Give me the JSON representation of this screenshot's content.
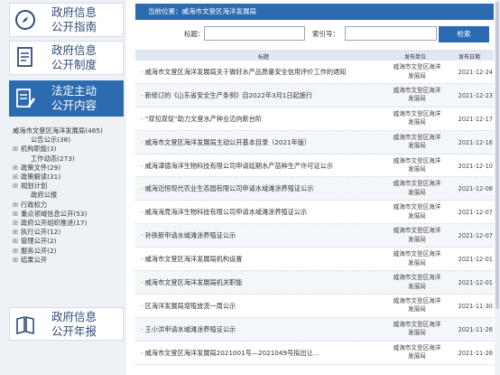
{
  "sidebar": {
    "nav": [
      {
        "line1": "政府信息",
        "line2": "公开指南",
        "icon": "compass-icon"
      },
      {
        "line1": "政府信息",
        "line2": "公开制度",
        "icon": "document-icon"
      },
      {
        "line1": "法定主动",
        "line2": "公开内容",
        "icon": "edit-document-icon"
      },
      {
        "line1": "政府信息",
        "line2": "公开年报",
        "icon": "report-icon"
      }
    ],
    "tree": {
      "root": "威海市文登区海洋发展局(465)",
      "items": [
        {
          "label": "公告公示(38)",
          "expandable": false
        },
        {
          "label": "机构职能(3)",
          "expandable": true
        },
        {
          "label": "工作动态(273)",
          "expandable": false
        },
        {
          "label": "政策文件(29)",
          "expandable": true
        },
        {
          "label": "政策解读(31)",
          "expandable": true
        },
        {
          "label": "规划计划",
          "expandable": true
        },
        {
          "label": "政府公报",
          "expandable": false
        },
        {
          "label": "行政权力",
          "expandable": true
        },
        {
          "label": "重点领域信息公开(53)",
          "expandable": true
        },
        {
          "label": "政府公开组织推进(17)",
          "expandable": true
        },
        {
          "label": "执行公开(12)",
          "expandable": true
        },
        {
          "label": "管理公开(2)",
          "expandable": true
        },
        {
          "label": "服务公开(2)",
          "expandable": true
        },
        {
          "label": "结果公开",
          "expandable": true
        }
      ]
    }
  },
  "content": {
    "breadcrumb": "当前位置：威海市文登区海洋发展局",
    "search": {
      "title_label": "标题：",
      "index_label": "索引号：",
      "button_label": "检索",
      "title_value": "",
      "index_value": ""
    },
    "table": {
      "headers": {
        "title": "标题",
        "unit": "发布单位",
        "date": "发布日期"
      },
      "rows": [
        {
          "title": "· 威海市文登区海洋发展局关于做好水产品质量安全信用评价工作的通知",
          "unit": "威海市文登区海洋发展局",
          "date": "2021-12-24"
        },
        {
          "title": "· 新修订的《山东省安全生产条例》自2022年3月1日起施行",
          "unit": "威海市文登区海洋发展局",
          "date": "2021-12-23"
        },
        {
          "title": "· “双包双促”助力文登水产种业迈向新台阶",
          "unit": "威海市文登区海洋发展局",
          "date": "2021-12-17"
        },
        {
          "title": "· 威海市文登区海洋发展局主动公开基本目录（2021年版）",
          "unit": "威海市文登区海洋发展局",
          "date": "2021-12-16"
        },
        {
          "title": "· 威海津德海洋生物科技有限公司申请延期水产苗种生产许可证公示",
          "unit": "威海市文登区海洋发展局",
          "date": "2021-12-10"
        },
        {
          "title": "· 威海迈恒现代农业生态园有限公司申请水域滩涂养殖证公示",
          "unit": "威海市文登区海洋发展局",
          "date": "2021-12-08"
        },
        {
          "title": "· 威海海竞海洋生物科技有限公司申请水域滩涂养殖证公示",
          "unit": "威海市文登区海洋发展局",
          "date": "2021-12-07"
        },
        {
          "title": "· 孙铁新申请水域滩涂养殖证公示",
          "unit": "威海市文登区海洋发展局",
          "date": "2021-12-07"
        },
        {
          "title": "· 威海市文登区海洋发展局机构设置",
          "unit": "威海市文登区海洋发展局",
          "date": "2021-12-01"
        },
        {
          "title": "· 威海市文登区海洋发展局机关职能",
          "unit": "威海市文登区海洋发展局",
          "date": "2021-12-01"
        },
        {
          "title": "· 区海洋发展局增殖放流一周公示",
          "unit": "威海市文登区海洋发展局",
          "date": "2021-11-30"
        },
        {
          "title": "· 王小洪申请水域滩涂养殖证公示",
          "unit": "威海市文登区海洋发展局",
          "date": "2021-11-26"
        },
        {
          "title": "· 威海市文登区海洋发展局2021001号—2021049号拟出让...",
          "unit": "威海市文登区海洋发展局",
          "date": "2021-11-26"
        }
      ]
    }
  },
  "colors": {
    "primary": "#2d6bb0",
    "sidebar_bg": "#eef2f7",
    "header_bg": "#dfe7f2"
  }
}
